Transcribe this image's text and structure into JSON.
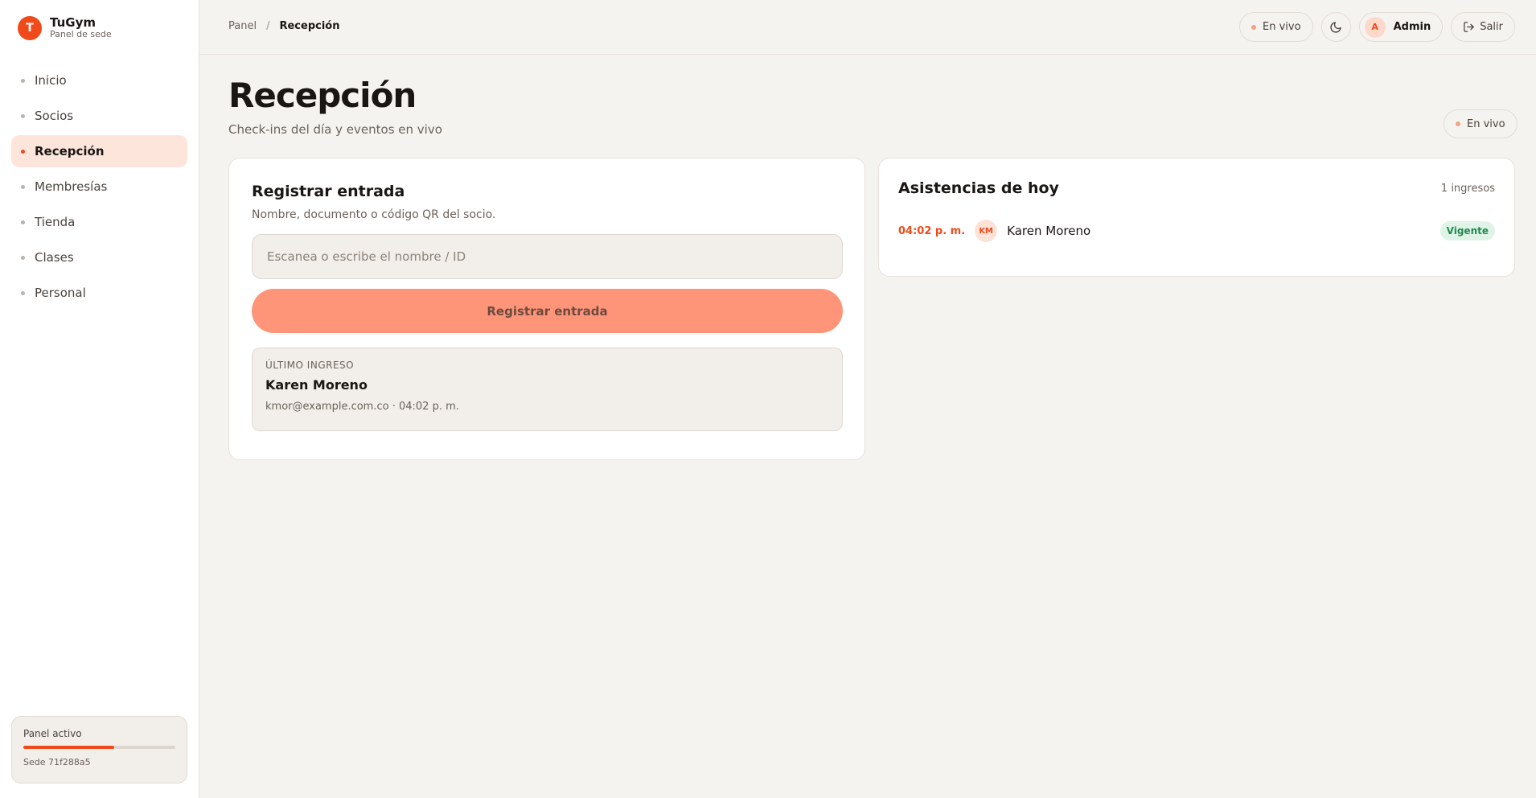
{
  "brand": {
    "initial": "T",
    "name": "TuGym",
    "subtitle": "Panel de sede"
  },
  "sidebar": {
    "items": [
      {
        "label": "Inicio",
        "active": false
      },
      {
        "label": "Socios",
        "active": false
      },
      {
        "label": "Recepción",
        "active": true
      },
      {
        "label": "Membresías",
        "active": false
      },
      {
        "label": "Tienda",
        "active": false
      },
      {
        "label": "Clases",
        "active": false
      },
      {
        "label": "Personal",
        "active": false
      }
    ],
    "panel": {
      "title": "Panel activo",
      "progress": 0.6,
      "subtitle": "Sede 71f288a5"
    }
  },
  "topbar": {
    "breadcrumb": {
      "root": "Panel",
      "separator": "/",
      "current": "Recepción"
    },
    "live_label": "En vivo",
    "theme_icon": "moon-icon",
    "admin": {
      "initial": "A",
      "name": "Admin"
    },
    "exit_label": "Salir",
    "exit_icon": "logout-icon"
  },
  "page": {
    "title": "Recepción",
    "subtitle": "Check-ins del día y eventos en vivo",
    "live_label": "En vivo"
  },
  "register": {
    "title": "Registrar entrada",
    "description": "Nombre, documento o código QR del socio.",
    "input_placeholder": "Escanea o escribe el nombre / ID",
    "input_value": "",
    "button_label": "Registrar entrada",
    "last": {
      "label": "ÚLTIMO INGRESO",
      "name": "Karen Moreno",
      "meta": "kmor@example.com.co · 04:02 p. m."
    }
  },
  "attendance": {
    "title": "Asistencias de hoy",
    "count_label": "1 ingresos",
    "rows": [
      {
        "time": "04:02 p. m.",
        "initials": "KM",
        "name": "Karen Moreno",
        "status": "Vigente"
      }
    ]
  },
  "colors": {
    "accent": "#f04a1a",
    "button": "#fe9478",
    "active_nav_bg": "#fde5dc",
    "status_green": "#1f8a4f",
    "live_dot": "#f4a28a"
  }
}
